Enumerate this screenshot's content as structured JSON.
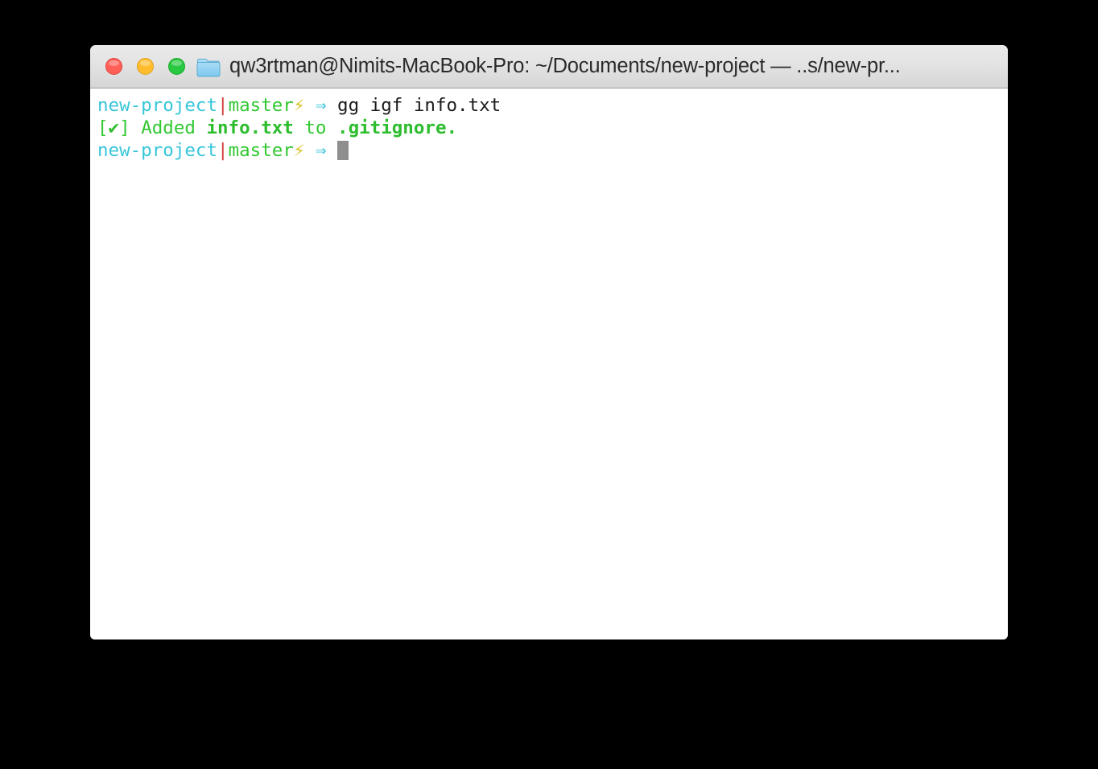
{
  "window": {
    "title": "qw3rtman@Nimits-MacBook-Pro: ~/Documents/new-project — ..s/new-pr...",
    "folder_icon": "folder-icon",
    "controls": {
      "close_label": "",
      "minimize_label": "",
      "maximize_label": ""
    },
    "colors": {
      "close": "#ff5f56",
      "minimize": "#ffbd2e",
      "maximize": "#28c840",
      "titlebar_top": "#eaeaea",
      "titlebar_bottom": "#d6d6d6",
      "body_background": "#ffffff",
      "cyan": "#38c6d9",
      "red": "#d43f3a",
      "green": "#32c832",
      "bolt_yellow": "#d6c327",
      "command": "#1a1a1a",
      "cursor": "#8e8e8e"
    }
  },
  "terminal": {
    "prompt": {
      "directory": "new-project",
      "separator": "|",
      "branch": "master",
      "dirty_glyph": "⚡",
      "arrow": "⇒"
    },
    "lines": [
      {
        "type": "prompt_command",
        "command": "gg igf info.txt"
      },
      {
        "type": "output",
        "bracket_open": "[",
        "check_glyph": "✔",
        "bracket_close": "]",
        "verb": "Added",
        "subject": "info.txt",
        "preposition": "to",
        "target": ".gitignore."
      },
      {
        "type": "prompt_cursor",
        "command": ""
      }
    ]
  }
}
